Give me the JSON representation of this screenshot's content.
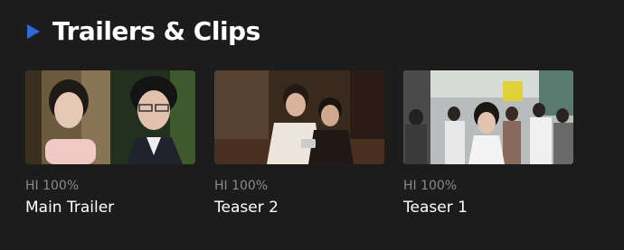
{
  "section": {
    "title": "Trailers & Clips",
    "icon": "play-icon",
    "accent": "#2f6ad6"
  },
  "clips": [
    {
      "meta": "HI 100%",
      "title": "Main Trailer"
    },
    {
      "meta": "HI 100%",
      "title": "Teaser 2"
    },
    {
      "meta": "HI 100%",
      "title": "Teaser 1"
    }
  ]
}
